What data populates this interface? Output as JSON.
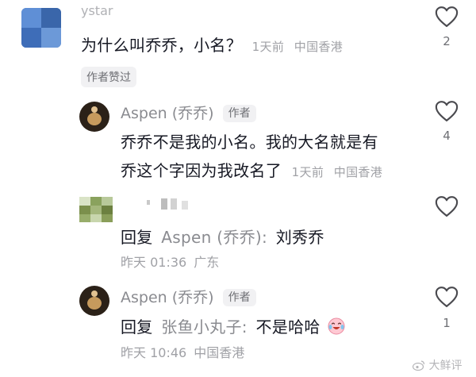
{
  "comments": [
    {
      "username": "уstar",
      "text": "为什么叫乔乔，小名？",
      "time": "1天前",
      "location": "中国香港",
      "badge": "作者赞过",
      "likes": "2"
    },
    {
      "username": "Aspen (乔乔)",
      "author_tag": "作者",
      "text_line1": "乔乔不是我的小名。我的大名就是有",
      "text_line2": "乔这个字因为我改名了",
      "time": "1天前",
      "location": "中国香港",
      "likes": "4"
    },
    {
      "reply_prefix": "回复",
      "reply_target": "Aspen (乔乔):",
      "reply_text": "刘秀乔",
      "date": "昨天 01:36",
      "location": "广东"
    },
    {
      "username": "Aspen (乔乔)",
      "author_tag": "作者",
      "reply_prefix": "回复",
      "reply_target": "张鱼小丸子:",
      "reply_text": "不是哈哈",
      "date": "昨天 10:46",
      "location": "中国香港",
      "likes": "1"
    }
  ],
  "watermark": "大鲜评",
  "colors": {
    "text": "#161823",
    "secondary": "#8a8b90",
    "heart_outline": "#4a4a4f"
  },
  "icons": [
    "heart-icon",
    "emoji-laugh-cry-icon",
    "weibo-logo-icon"
  ]
}
